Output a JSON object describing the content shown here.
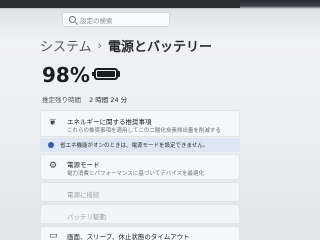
{
  "search": {
    "placeholder": "設定の検索"
  },
  "breadcrumb": {
    "parent": "システム",
    "separator": "›",
    "current": "電源とバッテリー"
  },
  "battery": {
    "percent": "98%",
    "level": 0.98
  },
  "remaining": {
    "label": "推定残り時間",
    "value": "2 時間 24 分"
  },
  "recommendations": {
    "icon": "leaf-icon",
    "title": "エネルギーに関する推奨事項",
    "subtitle": "これらの推奨事項を適用してこの二酸化炭素排出量を削減する"
  },
  "info_banner": {
    "text": "省エネ機能がオンのときは、電源モードを設定できません。"
  },
  "power_mode": {
    "icon": "power-mode-icon",
    "title": "電源モード",
    "subtitle": "電力消費とパフォーマンスに基づいてデバイスを最適化"
  },
  "rows": {
    "sleep": "電源に接続",
    "saver": "バッテリ駆動"
  },
  "timeouts": {
    "icon": "display-icon",
    "title": "画面、スリープ、休止状態のタイムアウト"
  },
  "colors": {
    "accent": "#2f5fa8",
    "banner": "#dde6f2"
  }
}
